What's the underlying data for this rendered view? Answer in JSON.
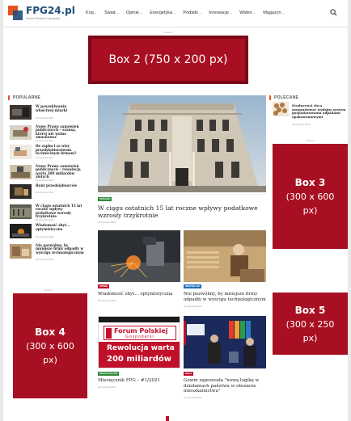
{
  "header": {
    "logo_text": "FPG24.pl",
    "logo_sub": "Forum Polskiej Gospodarki",
    "nav": [
      {
        "label": "Kraj"
      },
      {
        "label": "Świat"
      },
      {
        "label": "Opinie"
      },
      {
        "label": "Energetyka"
      },
      {
        "label": "Podatki"
      },
      {
        "label": "Innowacje"
      },
      {
        "label": "Wideo"
      },
      {
        "label": "Magazyn"
      }
    ],
    "caret": "⌄"
  },
  "ads": {
    "tag": "reklama",
    "box2": "Box 2 (750 x 200 px)",
    "box3": {
      "title": "Box 3",
      "size": "(300 x 600 px)"
    },
    "box5": {
      "title": "Box 5",
      "size": "(300 x 250 px)"
    },
    "box4": {
      "title": "Box 4",
      "size": "(300 x 600 px)"
    }
  },
  "sidebar_left": {
    "label": "POPULARNE",
    "items": [
      {
        "title": "W poszukiwaniu właściwej miarki",
        "date": "22 stycznia 2021"
      },
      {
        "title": "Nowe Prawo zamówień publicznych – szansa, której nie wolno zmarnować",
        "date": "22 stycznia 2021"
      },
      {
        "title": "Ile zapłaci za wizy przedsiębiorstwom technicznym firmom?",
        "date": "22 stycznia 2021"
      },
      {
        "title": "Nowe Prawo zamówień publicznych – rewolucja warta 200 miliardów złotych",
        "date": "22 stycznia 2021"
      },
      {
        "title": "Bunt przedsiębiorców",
        "date": "22 stycznia 2021"
      },
      {
        "title": "W ciągu ostatnich 15 lat roczne wpływy podatkowe wzrosły trzykrotnie",
        "date": "22 stycznia 2021"
      },
      {
        "title": "Wiadomość zbyt... optymistyczna",
        "date": "22 stycznia 2021"
      },
      {
        "title": "Nie pozwólmy, by mniejsze firmy odpadły w wyścigu technologicznym",
        "date": "22 stycznia 2021"
      }
    ]
  },
  "main": {
    "hero": {
      "badge": "PODATKI",
      "title": "W ciągu ostatnich 15 lat roczne wpływy podatkowe wzrosły trzykrotnie",
      "date": "22 stycznia 2021"
    },
    "cards": [
      {
        "badge": "OPINIE",
        "title": "Wiadomość zbyt... optymistyczna",
        "date": "22 stycznia 2021"
      },
      {
        "badge": "INNOWACJE",
        "title": "Nie pozwólmy, by mniejsze firmy odpadły w wyścigu technologicznym",
        "date": "22 stycznia 2021"
      },
      {
        "badge": "MAGAZYN FPG",
        "title": "Miesięcznik FPG – #1/2021",
        "date": "22 stycznia 2021",
        "cover": {
          "line1": "Forum Polskiej",
          "line2": "Gospodarki",
          "line3": "Rewolucja warta",
          "line4": "200 miliardów"
        }
      },
      {
        "badge": "KRAJ",
        "title": "Gowin zapowiada \"nową logikę w działaniach państwa w obszarze mieszkalnictwa\"",
        "date": "22 stycznia 2021"
      }
    ]
  },
  "sidebar_right": {
    "label": "POLECANE",
    "item": {
      "title": "Producenci chcą zorganizować wydajny system gospodarowania odpadami opakowaniowymi",
      "date": "22 stycznia 2021"
    }
  },
  "colors": {
    "accent": "#e8521c",
    "ad": "#a90f22",
    "brand": "#1f4e79"
  }
}
